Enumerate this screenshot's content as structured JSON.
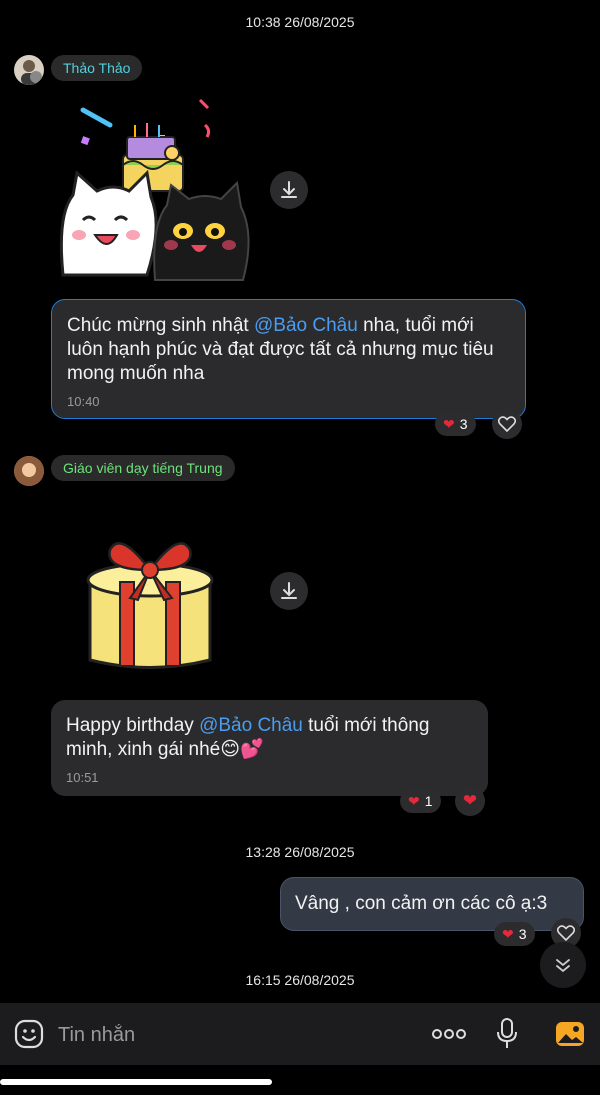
{
  "timestamps": {
    "t1": "10:38 26/08/2025",
    "t2": "13:28 26/08/2025",
    "t3": "16:15 26/08/2025"
  },
  "messages": [
    {
      "sender": "Thảo Thảo",
      "sender_color": "#4fd1e0",
      "text_before": "Chúc mừng sinh nhật ",
      "mention": "@Bảo Châu",
      "text_after": " nha, tuổi mới luôn hạnh phúc và đạt được tất cả nhưng mục tiêu mong muốn nha",
      "time": "10:40",
      "reaction_count": "3"
    },
    {
      "sender": "Giáo viên dạy tiếng Trung",
      "sender_color": "#6ee27a",
      "text_before": "Happy birthday ",
      "mention": "@Bảo Châu",
      "text_after": " tuổi mới thông minh, xinh gái  nhé😊💕",
      "time": "10:51",
      "reaction_count": "1"
    }
  ],
  "sent_message": {
    "text": "Vâng , con cảm ơn các cô ạ:3",
    "reaction_count": "3"
  },
  "input": {
    "placeholder": "Tin nhắn"
  },
  "colors": {
    "accent_blue": "#4a9df0",
    "heart_red": "#e5283a",
    "gallery_orange": "#f5a623"
  }
}
